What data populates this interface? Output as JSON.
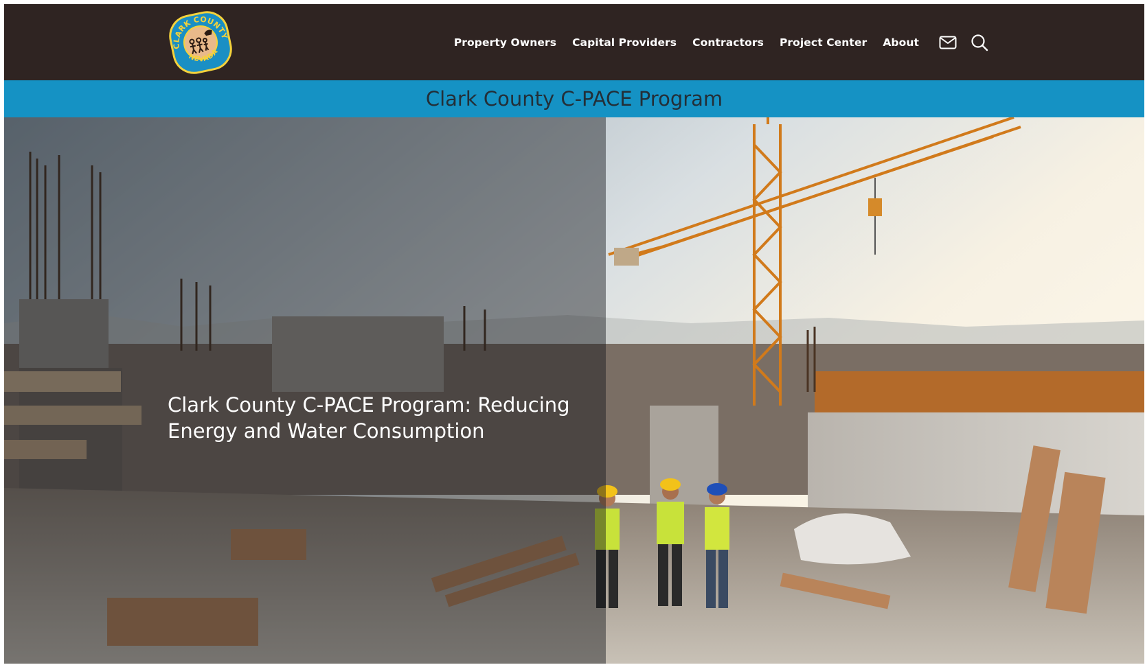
{
  "header": {
    "logo": {
      "text_top": "CLARK COUNTY",
      "text_bottom": "NEVADA",
      "colors": {
        "outer": "#1a8fc4",
        "inner": "#e9b98a",
        "ring": "#f4d23c"
      }
    },
    "nav": {
      "items": [
        {
          "label": "Property Owners"
        },
        {
          "label": "Capital Providers"
        },
        {
          "label": "Contractors"
        },
        {
          "label": "Project Center"
        },
        {
          "label": "About"
        }
      ],
      "icons": [
        "envelope-icon",
        "search-icon"
      ]
    },
    "colors": {
      "background": "#2f2422",
      "text": "#ffffff"
    }
  },
  "band": {
    "title": "Clark County C-PACE Program",
    "colors": {
      "background": "#1592c4",
      "text": "#232f38"
    }
  },
  "hero": {
    "heading": "Clark County C-PACE Program: Reducing Energy and Water Consumption",
    "image": "construction-site-with-crane-and-workers"
  }
}
